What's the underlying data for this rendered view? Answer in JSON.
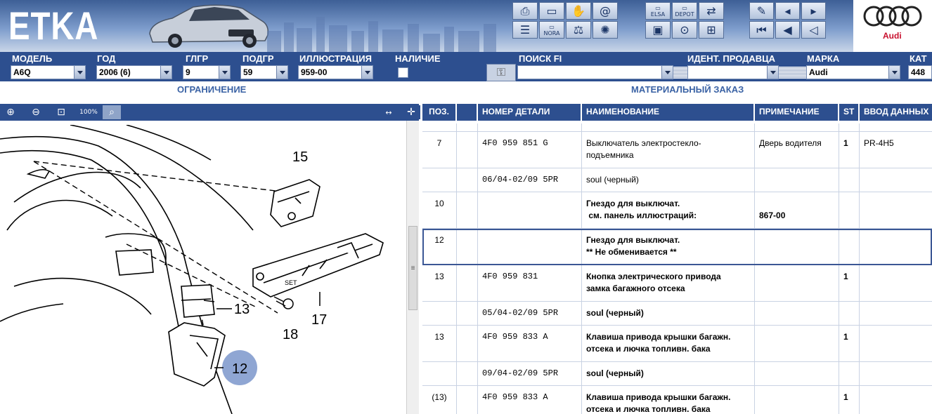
{
  "app": {
    "logo": "ETKA",
    "brand": "Audi"
  },
  "toolbar_icons": [
    "printer-icon",
    "window-icon",
    "handshake-icon",
    "at-email-icon",
    "list-icon",
    "nora-icon",
    "scale-icon",
    "wheel-icon",
    "elsa-icon",
    "depot-icon",
    "cart-transfer-icon",
    "monitor-car-icon",
    "cart-icon",
    "pin-icon",
    "page-back-icon",
    "page-forward-icon",
    "first-icon",
    "prev-icon",
    "back-icon"
  ],
  "toolbar_labels": {
    "nora": "NORA",
    "elsa": "ELSA",
    "depot": "DEPOT"
  },
  "selectors": {
    "model": {
      "label": "МОДЕЛЬ",
      "value": "A6Q"
    },
    "year": {
      "label": "ГОД",
      "value": "2006 (6)"
    },
    "main_group": {
      "label": "ГЛГР",
      "value": "9"
    },
    "sub_group": {
      "label": "ПОДГР",
      "value": "59"
    },
    "illustration": {
      "label": "ИЛЛЮСТРАЦИЯ",
      "value": "959-00"
    },
    "availability": {
      "label": "НАЛИЧИЕ"
    },
    "search_fi": {
      "label": "ПОИСК FI",
      "value": ""
    },
    "dealer_id": {
      "label": "ИДЕНТ. ПРОДАВЦА",
      "value": ""
    },
    "brand": {
      "label": "МАРКА",
      "value": "Audi"
    },
    "catalog": {
      "label": "КАТ",
      "value": "448"
    }
  },
  "subheaders": {
    "restriction": "ОГРАНИЧЕНИЕ",
    "material_order": "МАТЕРИАЛЬНЫЙ ЗАКАЗ"
  },
  "illustration": {
    "callouts": [
      "15",
      "17",
      "13",
      "18",
      "12"
    ],
    "highlighted": "12",
    "zoom_labels": {
      "zoom_100": "100%"
    }
  },
  "table": {
    "headers": {
      "pos": "ПОЗ.",
      "part_no": "НОМЕР ДЕТАЛИ",
      "name": "НАИМЕНОВАНИЕ",
      "note": "ПРИМЕЧАНИЕ",
      "st": "ST",
      "input": "ВВОД ДАННЫХ"
    },
    "rows": [
      {
        "pos": "7",
        "part": "4F0 959 851 G",
        "name": "Выключатель электростекло-",
        "name2": "подъемника",
        "note": "Дверь водителя",
        "st": "1",
        "input": "PR-4H5"
      },
      {
        "pos": "",
        "part": "06/04-02/09 5PR",
        "name": "soul (черный)",
        "name2": "",
        "note": "",
        "st": "",
        "input": ""
      },
      {
        "pos": "10",
        "part": "",
        "name": "Гнездо для выключат.",
        "name2": " см. панель иллюстраций:",
        "note": "",
        "note2": "867-00",
        "st": "",
        "input": ""
      },
      {
        "pos": "12",
        "part": "",
        "name": "Гнездо для выключат.",
        "name2": "** Не обменивается **",
        "note": "",
        "st": "",
        "input": ""
      },
      {
        "pos": "13",
        "part": "4F0 959 831",
        "name": "Кнопка электрического привода",
        "name2": "замка багажного отсека",
        "note": "",
        "st": "1",
        "input": ""
      },
      {
        "pos": "",
        "part": "05/04-02/09 5PR",
        "name": "soul (черный)",
        "name2": "",
        "note": "",
        "st": "",
        "input": ""
      },
      {
        "pos": "13",
        "part": "4F0 959 833 A",
        "name": "Клавиша привода крышки багажн.",
        "name2": "отсека и лючка топливн. бака",
        "note": "",
        "st": "1",
        "input": ""
      },
      {
        "pos": "",
        "part": "09/04-02/09 5PR",
        "name": "soul (черный)",
        "name2": "",
        "note": "",
        "st": "",
        "input": ""
      },
      {
        "pos": "(13)",
        "part": "4F0 959 833 A",
        "name": "Клавиша привода крышки багажн.",
        "name2": "отсека и лючка топливн. бака",
        "note": "",
        "st": "1",
        "input": ""
      }
    ]
  },
  "colors": {
    "nav_blue": "#2d4f8f",
    "highlight_circle": "#8fa6d3",
    "audi_red": "#c8102e"
  }
}
